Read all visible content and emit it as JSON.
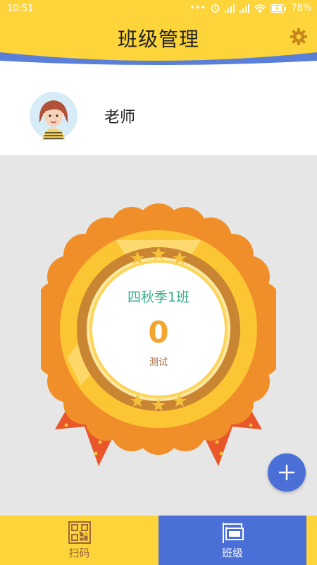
{
  "status": {
    "time": "10:51",
    "battery": "78%"
  },
  "header": {
    "title": "班级管理"
  },
  "profile": {
    "name": "老师"
  },
  "class_card": {
    "name": "四秋季1班",
    "score": "0",
    "subtitle": "测试"
  },
  "tabs": [
    {
      "label": "扫码",
      "icon": "qr-code-icon"
    },
    {
      "label": "班级",
      "icon": "class-sign-icon"
    }
  ],
  "colors": {
    "yellow": "#fdd43a",
    "blue": "#4a6fd6",
    "teal": "#3bab8c",
    "orange": "#f3a530"
  }
}
